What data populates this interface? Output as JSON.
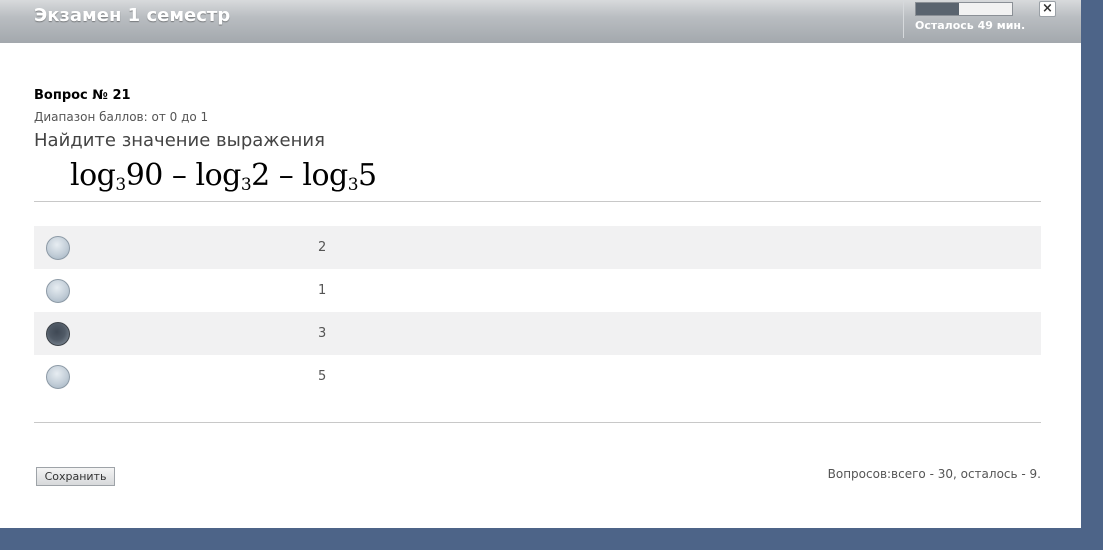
{
  "window": {
    "title": "Экзамен 1 семестр",
    "close_icon": "×"
  },
  "timer": {
    "remaining_text": "Осталось 49 мин.",
    "progress_fraction": 0.45
  },
  "question": {
    "number_label": "Вопрос № 21",
    "score_range": "Диапазон баллов: от 0 до 1",
    "prompt": "Найдите значение выражения",
    "formula": {
      "term1_fn": "log",
      "term1_base": "3",
      "term1_arg": "90",
      "op1": " – ",
      "term2_fn": "log",
      "term2_base": "3",
      "term2_arg": "2",
      "op2": " – ",
      "term3_fn": "log",
      "term3_base": "3",
      "term3_arg": "5"
    }
  },
  "answers": [
    {
      "label": "2",
      "selected": false
    },
    {
      "label": "1",
      "selected": false
    },
    {
      "label": "3",
      "selected": true
    },
    {
      "label": "5",
      "selected": false
    }
  ],
  "footer": {
    "save_label": "Сохранить",
    "questions_info": "Вопросов:всего - 30, осталось - 9."
  },
  "colors": {
    "background": "#4d6488",
    "titlebar": "#b9bdc1",
    "row_alt": "#f1f1f2"
  }
}
